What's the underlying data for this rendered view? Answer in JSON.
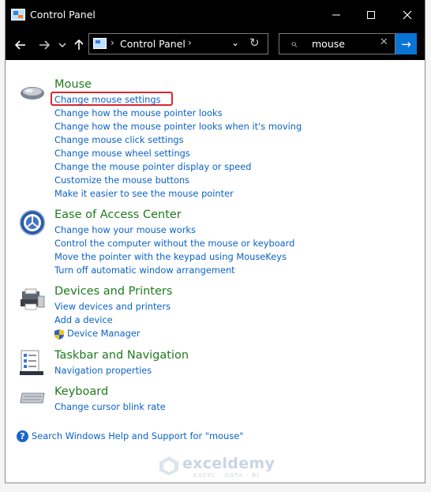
{
  "window": {
    "title": "Control Panel",
    "minimize_icon": "minimize-icon",
    "maximize_icon": "maximize-icon",
    "close_icon": "close-icon"
  },
  "nav": {
    "back_icon": "back-arrow-icon",
    "forward_icon": "forward-arrow-icon",
    "recent_icon": "chevron-down-icon",
    "up_icon": "up-arrow-icon",
    "breadcrumb": "Control Panel",
    "refresh_icon": "refresh-icon"
  },
  "search": {
    "value": "mouse",
    "clear_icon": "clear-icon",
    "go_icon": "go-arrow-icon"
  },
  "groups": [
    {
      "title": "Mouse",
      "icon": "mouse-icon",
      "links": [
        "Change mouse settings",
        "Change how the mouse pointer looks",
        "Change how the mouse pointer looks when it's moving",
        "Change mouse click settings",
        "Change mouse wheel settings",
        "Change the mouse pointer display or speed",
        "Customize the mouse buttons",
        "Make it easier to see the mouse pointer"
      ]
    },
    {
      "title": "Ease of Access Center",
      "icon": "ease-of-access-icon",
      "links": [
        "Change how your mouse works",
        "Control the computer without the mouse or keyboard",
        "Move the pointer with the keypad using MouseKeys",
        "Turn off automatic window arrangement"
      ]
    },
    {
      "title": "Devices and Printers",
      "icon": "printer-icon",
      "links": [
        "View devices and printers",
        "Add a device",
        "Device Manager"
      ]
    },
    {
      "title": "Taskbar and Navigation",
      "icon": "taskbar-icon",
      "links": [
        "Navigation properties"
      ]
    },
    {
      "title": "Keyboard",
      "icon": "keyboard-icon",
      "links": [
        "Change cursor blink rate"
      ]
    }
  ],
  "help": {
    "text": "Search Windows Help and Support for \"mouse\""
  },
  "watermark": {
    "name": "exceldemy",
    "tagline": "EXCEL · DATA · BI"
  },
  "colors": {
    "titlebar": "#000000",
    "group_title": "#1e7b1e",
    "link": "#0b62c8",
    "highlight": "#d9272e",
    "go_button": "#0a74d6"
  }
}
